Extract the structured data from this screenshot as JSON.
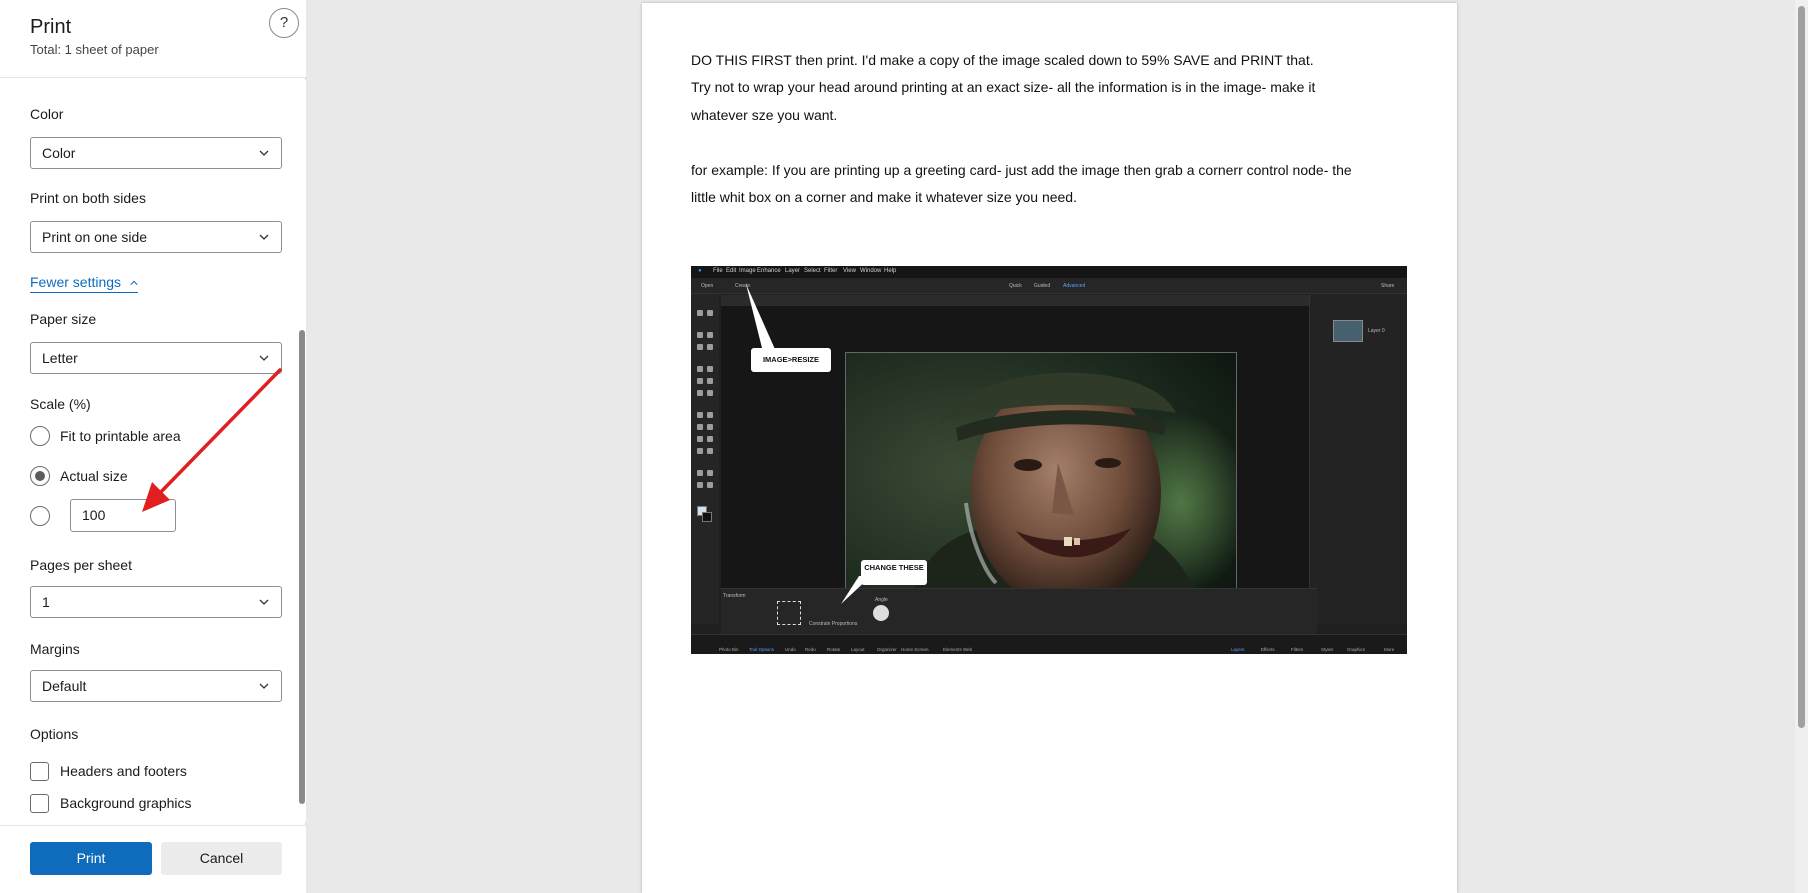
{
  "panel": {
    "title": "Print",
    "total": "Total: 1 sheet of paper",
    "help": "?",
    "color": {
      "label": "Color",
      "value": "Color"
    },
    "duplex": {
      "label": "Print on both sides",
      "value": "Print on one side"
    },
    "fewer_settings": "Fewer settings",
    "paper_size": {
      "label": "Paper size",
      "value": "Letter"
    },
    "scale": {
      "label": "Scale (%)",
      "options": [
        "Fit to printable area",
        "Actual size"
      ],
      "selected": "Actual size",
      "custom_value": "100"
    },
    "pages_per_sheet": {
      "label": "Pages per sheet",
      "value": "1"
    },
    "margins": {
      "label": "Margins",
      "value": "Default"
    },
    "options": {
      "label": "Options",
      "items": [
        "Headers and footers",
        "Background graphics"
      ]
    },
    "print_button": "Print",
    "cancel_button": "Cancel"
  },
  "document": {
    "lines": [
      "DO THIS FIRST then print.   I'd make a copy of the image scaled down to 59% SAVE and PRINT that.",
      "Try not to wrap your head around printing at an exact size- all the information is in the image- make it",
      "whatever sze you want.",
      "for example:  If you are printing up a greeting card- just add the image then grab a cornerr control node- the",
      "little whit box on a corner and make it whatever size you need."
    ],
    "screenshot": {
      "menu": [
        "File",
        "Edit",
        "Image",
        "Enhance",
        "Layer",
        "Select",
        "Filter",
        "View",
        "Window",
        "Help"
      ],
      "modes": [
        "Quick",
        "Guided",
        "Advanced"
      ],
      "open_label": "Open",
      "create_label": "Create",
      "share_label": "Share",
      "callout_resize": "IMAGE>RESIZE",
      "callout_change": "CHANGE THESE",
      "layer_name": "Layer 0",
      "transform_label": "Transform",
      "constrain_label": "Constrain Proportions",
      "angle_label": "Angle",
      "footer_items": [
        "Photo Bin",
        "Tool Options",
        "Undo",
        "Redo",
        "Rotate",
        "Layout",
        "Organizer",
        "Home Screen",
        "Elements Web"
      ],
      "footer_right": [
        "Layers",
        "Effects",
        "Filters",
        "Styles",
        "Graphics",
        "More"
      ]
    }
  },
  "colors": {
    "accent": "#0f6cbd",
    "arrow": "#e02020"
  }
}
